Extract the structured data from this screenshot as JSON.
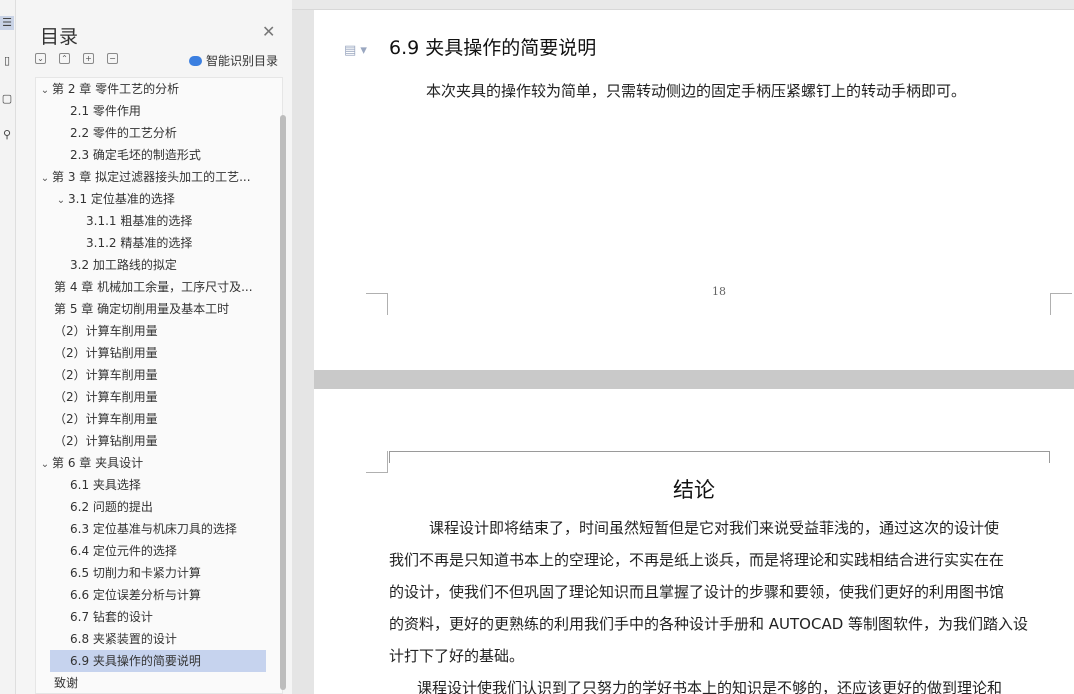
{
  "rail": {
    "icons": [
      "list-icon",
      "bookmark-icon",
      "note-icon",
      "search-icon"
    ]
  },
  "nav": {
    "title": "目录",
    "smart_label": "智能识别目录",
    "toc": [
      {
        "label": "第 2 章 零件工艺的分析",
        "level": 0,
        "arrow": true,
        "selected": false
      },
      {
        "label": "2.1 零件作用",
        "level": 1,
        "arrow": false,
        "selected": false
      },
      {
        "label": "2.2 零件的工艺分析",
        "level": 1,
        "arrow": false,
        "selected": false
      },
      {
        "label": "2.3 确定毛坯的制造形式",
        "level": 1,
        "arrow": false,
        "selected": false
      },
      {
        "label": "第 3 章 拟定过滤器接头加工的工艺...",
        "level": 0,
        "arrow": true,
        "selected": false
      },
      {
        "label": "3.1 定位基准的选择",
        "level": 1,
        "arrow": true,
        "selected": false
      },
      {
        "label": "3.1.1 粗基准的选择",
        "level": 2,
        "arrow": false,
        "selected": false
      },
      {
        "label": "3.1.2 精基准的选择",
        "level": 2,
        "arrow": false,
        "selected": false
      },
      {
        "label": "3.2 加工路线的拟定",
        "level": 1,
        "arrow": false,
        "selected": false
      },
      {
        "label": "第 4 章 机械加工余量，工序尺寸及...",
        "level": 0,
        "arrow": false,
        "selected": false
      },
      {
        "label": "第 5 章 确定切削用量及基本工时",
        "level": 0,
        "arrow": false,
        "selected": false
      },
      {
        "label": "（2）计算车削用量",
        "level": 0,
        "arrow": false,
        "selected": false
      },
      {
        "label": "（2）计算钻削用量",
        "level": 0,
        "arrow": false,
        "selected": false
      },
      {
        "label": "（2）计算车削用量",
        "level": 0,
        "arrow": false,
        "selected": false
      },
      {
        "label": "（2）计算车削用量",
        "level": 0,
        "arrow": false,
        "selected": false
      },
      {
        "label": "（2）计算车削用量",
        "level": 0,
        "arrow": false,
        "selected": false
      },
      {
        "label": "（2）计算钻削用量",
        "level": 0,
        "arrow": false,
        "selected": false
      },
      {
        "label": "第 6 章 夹具设计",
        "level": 0,
        "arrow": true,
        "selected": false
      },
      {
        "label": "6.1 夹具选择",
        "level": 1,
        "arrow": false,
        "selected": false
      },
      {
        "label": "6.2 问题的提出",
        "level": 1,
        "arrow": false,
        "selected": false
      },
      {
        "label": "6.3 定位基准与机床刀具的选择",
        "level": 1,
        "arrow": false,
        "selected": false
      },
      {
        "label": "6.4 定位元件的选择",
        "level": 1,
        "arrow": false,
        "selected": false
      },
      {
        "label": "6.5 切削力和卡紧力计算",
        "level": 1,
        "arrow": false,
        "selected": false
      },
      {
        "label": "6.6 定位误差分析与计算",
        "level": 1,
        "arrow": false,
        "selected": false
      },
      {
        "label": "6.7 钻套的设计",
        "level": 1,
        "arrow": false,
        "selected": false
      },
      {
        "label": "6.8 夹紧装置的设计",
        "level": 1,
        "arrow": false,
        "selected": false
      },
      {
        "label": "6.9 夹具操作的简要说明",
        "level": 1,
        "arrow": false,
        "selected": true
      },
      {
        "label": "致谢",
        "level": 0,
        "arrow": false,
        "selected": false
      }
    ]
  },
  "document": {
    "section_heading": "6.9 夹具操作的简要说明",
    "section_text": "本次夹具的操作较为简单，只需转动侧边的固定手柄压紧螺钉上的转动手柄即可。",
    "page_number": "18",
    "conclusion_title": "结论",
    "conclusion_lines": [
      "课程设计即将结束了，时间虽然短暂但是它对我们来说受益菲浅的，通过这次的设计使",
      "我们不再是只知道书本上的空理论，不再是纸上谈兵，而是将理论和实践相结合进行实实在在",
      "的设计，使我们不但巩固了理论知识而且掌握了设计的步骤和要领，使我们更好的利用图书馆",
      "的资料，更好的更熟练的利用我们手中的各种设计手册和 AUTOCAD 等制图软件，为我们踏入设",
      "计打下了好的基础。",
      "课程设计使我们认识到了只努力的学好书本上的知识是不够的，还应该更好的做到理论和"
    ]
  }
}
